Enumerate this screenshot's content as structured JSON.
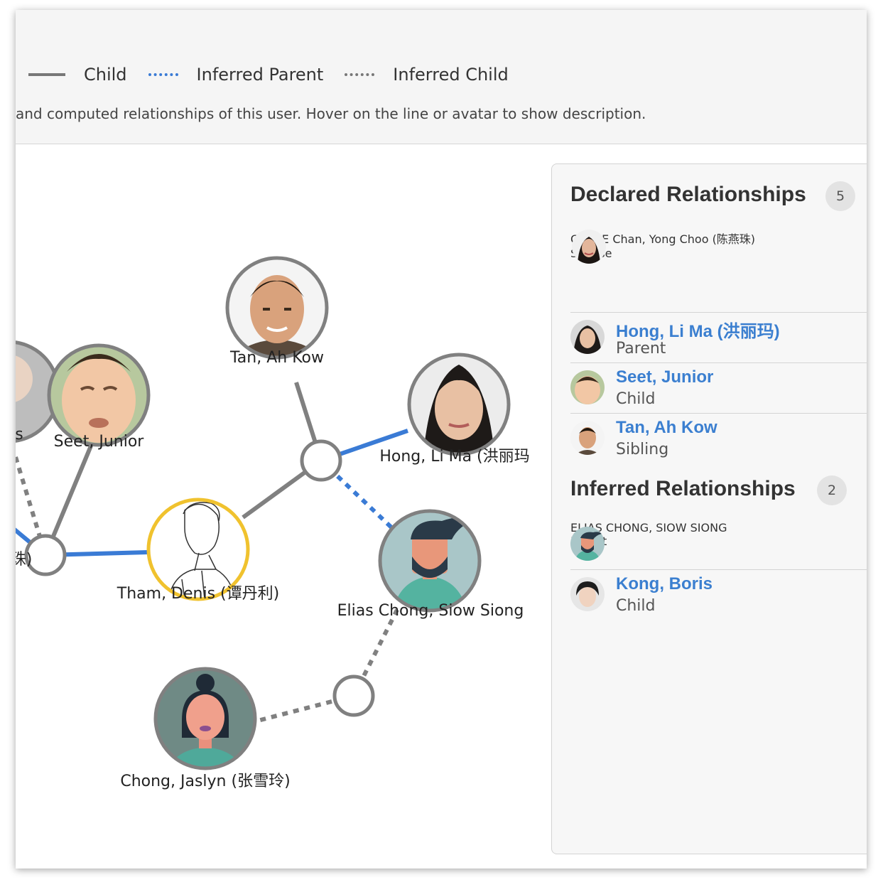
{
  "legend": {
    "items": [
      {
        "label": "Child"
      },
      {
        "label": "Inferred Parent"
      },
      {
        "label": "Inferred Child"
      }
    ],
    "description": "and computed relationships of this user. Hover on the line or avatar to show description."
  },
  "graph": {
    "nodes": [
      {
        "label": "s"
      },
      {
        "label": "Seet, Junior"
      },
      {
        "label": "Tan, Ah Kow"
      },
      {
        "label": "Hong, Li Ma (洪丽玛"
      },
      {
        "label": "珠)"
      },
      {
        "label": "Tham, Denis (谭丹利)"
      },
      {
        "label": "Elias Chong, Siow Siong"
      },
      {
        "label": "Chong, Jaslyn (张雪玲)"
      }
    ]
  },
  "colors": {
    "declared_line": "#3a7bd5",
    "line": "#808080",
    "focus_ring": "#f0c22e",
    "link": "#3b7fd0"
  },
  "panel": {
    "declared": {
      "title": "Declared Relationships",
      "count": "5",
      "items": [
        {
          "name": "CHLOE Chan, Yong Choo (陈燕珠)",
          "relation": "Spouse"
        },
        {
          "name": "Hong, Li Ma (洪丽玛)",
          "relation": "Parent"
        },
        {
          "name": "Seet, Junior",
          "relation": "Child"
        },
        {
          "name": "Tan, Ah Kow",
          "relation": "Sibling"
        }
      ]
    },
    "inferred": {
      "title": "Inferred Relationships",
      "count": "2",
      "items": [
        {
          "name": "ELIAS CHONG, SIOW SIONG",
          "relation": "Parent"
        },
        {
          "name": "Kong, Boris",
          "relation": "Child"
        }
      ]
    }
  }
}
